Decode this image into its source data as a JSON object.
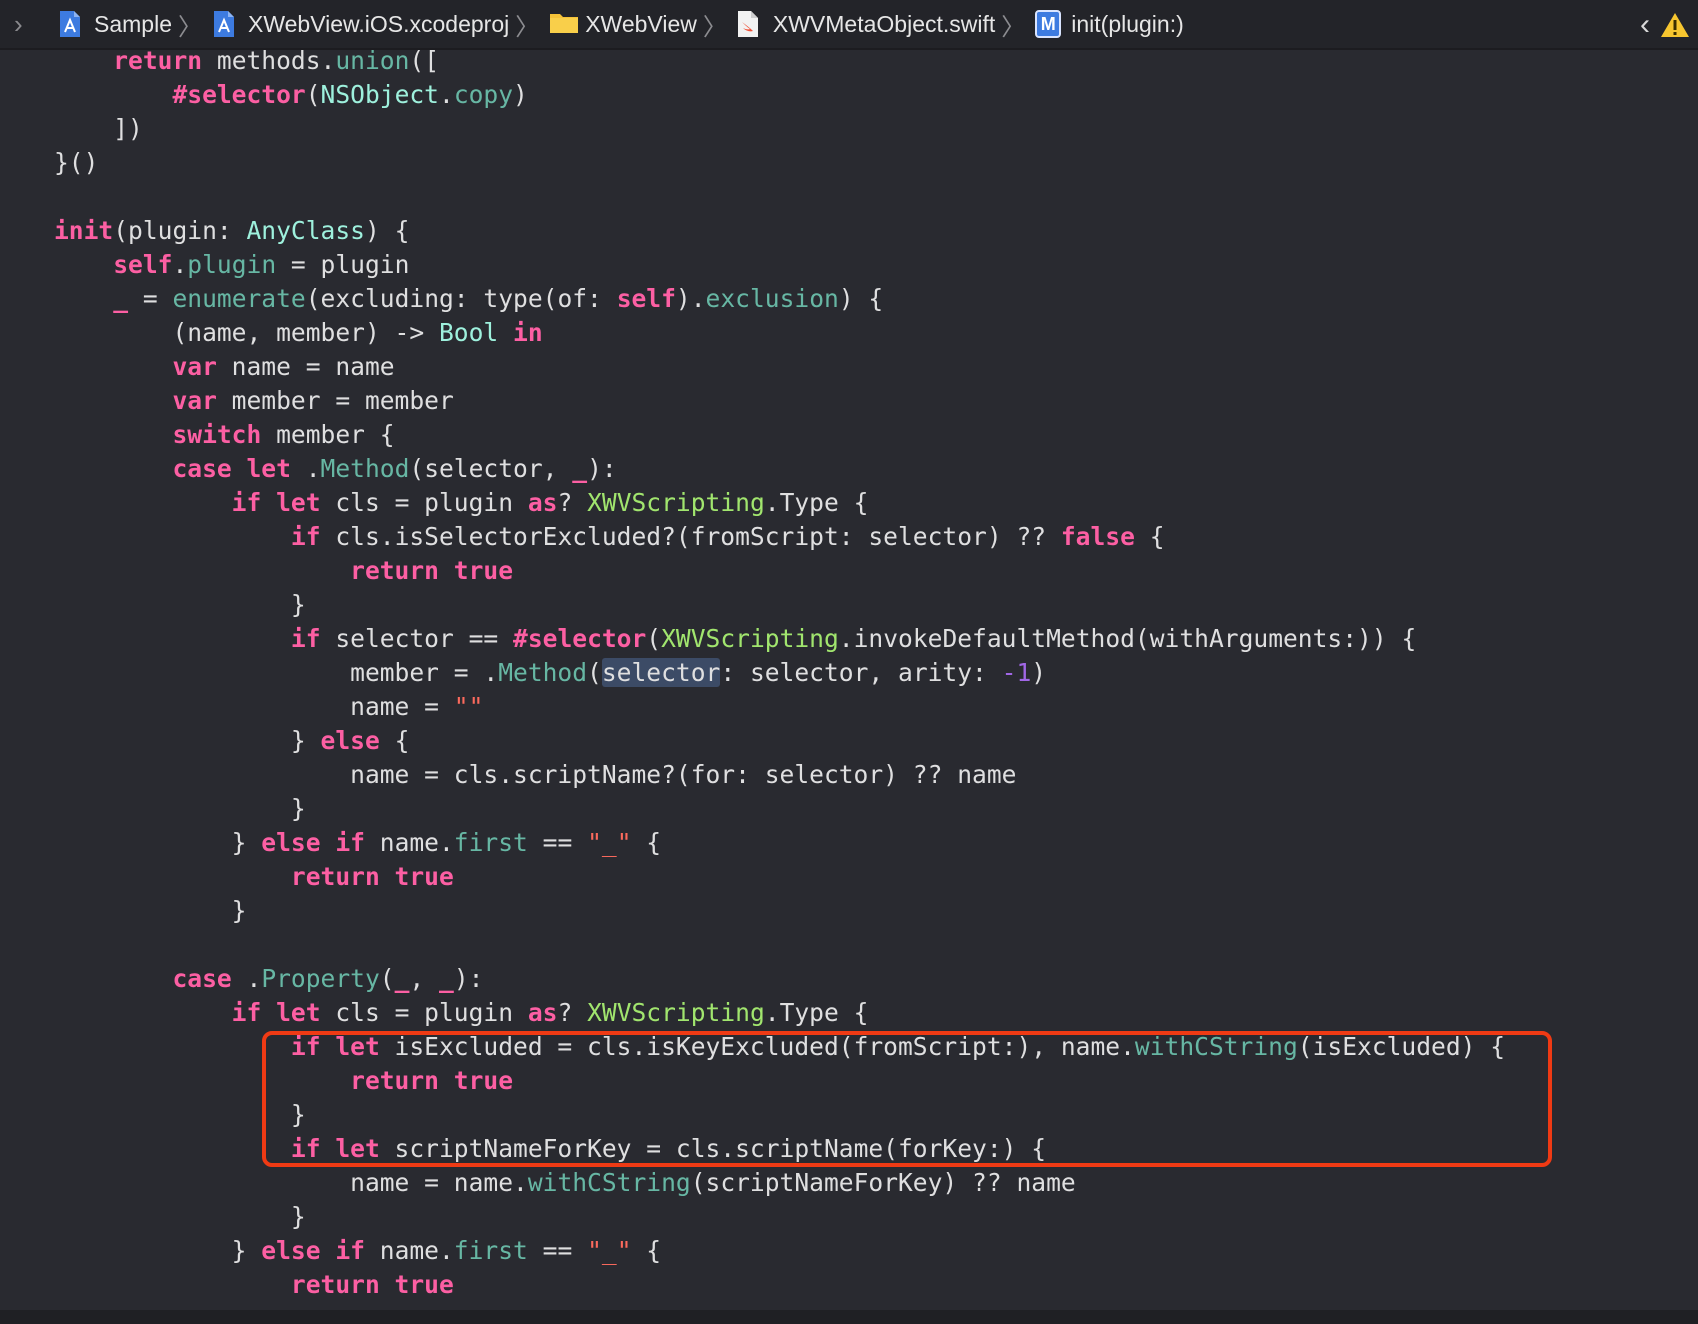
{
  "breadcrumb": [
    {
      "label": "Sample",
      "icon": "xcode-project-icon"
    },
    {
      "label": "XWebView.iOS.xcodeproj",
      "icon": "xcode-project-icon"
    },
    {
      "label": "XWebView",
      "icon": "folder-icon"
    },
    {
      "label": "XWVMetaObject.swift",
      "icon": "swift-file-icon"
    },
    {
      "label": "init(plugin:)",
      "icon": "method-symbol-icon"
    }
  ],
  "method_badge": "M",
  "editor": {
    "lines": [
      [
        [
          "    return",
          "kw"
        ],
        [
          " methods.",
          ""
        ],
        [
          "union",
          "proj"
        ],
        [
          "([",
          ""
        ]
      ],
      [
        [
          "        #selector",
          "kw"
        ],
        [
          "(",
          ""
        ],
        [
          "NSObject",
          "cls"
        ],
        [
          ".",
          ""
        ],
        [
          "copy",
          "proj"
        ],
        [
          ")",
          ""
        ]
      ],
      [
        [
          "    ])",
          ""
        ]
      ],
      [
        [
          "}()",
          ""
        ]
      ],
      [
        [
          "",
          ""
        ]
      ],
      [
        [
          "init",
          "kw"
        ],
        [
          "(plugin: ",
          ""
        ],
        [
          "AnyClass",
          "cls"
        ],
        [
          ") {",
          ""
        ]
      ],
      [
        [
          "    self",
          "kw"
        ],
        [
          ".",
          ""
        ],
        [
          "plugin",
          "proj"
        ],
        [
          " = plugin",
          ""
        ]
      ],
      [
        [
          "    _",
          "kw"
        ],
        [
          " = ",
          ""
        ],
        [
          "enumerate",
          "proj"
        ],
        [
          "(excluding: type(of: ",
          ""
        ],
        [
          "self",
          "kw"
        ],
        [
          ").",
          ""
        ],
        [
          "exclusion",
          "proj"
        ],
        [
          ") {",
          ""
        ]
      ],
      [
        [
          "        (name, member) -> ",
          ""
        ],
        [
          "Bool",
          "cls"
        ],
        [
          " ",
          ""
        ],
        [
          "in",
          "kw"
        ]
      ],
      [
        [
          "        var",
          "kw"
        ],
        [
          " name = name",
          ""
        ]
      ],
      [
        [
          "        var",
          "kw"
        ],
        [
          " member = member",
          ""
        ]
      ],
      [
        [
          "        switch",
          "kw"
        ],
        [
          " member {",
          ""
        ]
      ],
      [
        [
          "        case let",
          "kw"
        ],
        [
          " .",
          ""
        ],
        [
          "Method",
          "proj"
        ],
        [
          "(selector, ",
          ""
        ],
        [
          "_",
          "kw"
        ],
        [
          "):",
          ""
        ]
      ],
      [
        [
          "            if let",
          "kw"
        ],
        [
          " cls = plugin ",
          ""
        ],
        [
          "as",
          "kw"
        ],
        [
          "? ",
          ""
        ],
        [
          "XWVScripting",
          "pf"
        ],
        [
          ".Type {",
          ""
        ]
      ],
      [
        [
          "                if",
          "kw"
        ],
        [
          " cls.isSelectorExcluded?(fromScript: selector) ?? ",
          ""
        ],
        [
          "false",
          "kw"
        ],
        [
          " {",
          ""
        ]
      ],
      [
        [
          "                    return true",
          "kw"
        ]
      ],
      [
        [
          "                }",
          ""
        ]
      ],
      [
        [
          "                if",
          "kw"
        ],
        [
          " selector == ",
          ""
        ],
        [
          "#selector",
          "kw"
        ],
        [
          "(",
          ""
        ],
        [
          "XWVScripting",
          "pf"
        ],
        [
          ".invokeDefaultMethod(withArguments:)) {",
          ""
        ]
      ],
      [
        [
          "                    member = .",
          ""
        ],
        [
          "Method",
          "proj"
        ],
        [
          "(",
          ""
        ],
        [
          "selector",
          "hl"
        ],
        [
          ": selector, arity: ",
          ""
        ],
        [
          "-1",
          "sym"
        ],
        [
          ")",
          ""
        ]
      ],
      [
        [
          "                    name = ",
          ""
        ],
        [
          "\"\"",
          "str"
        ]
      ],
      [
        [
          "                } ",
          ""
        ],
        [
          "else",
          "kw"
        ],
        [
          " {",
          ""
        ]
      ],
      [
        [
          "                    name = cls.scriptName?(for: selector) ?? name",
          ""
        ]
      ],
      [
        [
          "                }",
          ""
        ]
      ],
      [
        [
          "            } ",
          ""
        ],
        [
          "else if",
          "kw"
        ],
        [
          " name.",
          ""
        ],
        [
          "first",
          "proj"
        ],
        [
          " == ",
          ""
        ],
        [
          "\"_\"",
          "str"
        ],
        [
          " {",
          ""
        ]
      ],
      [
        [
          "                return true",
          "kw"
        ]
      ],
      [
        [
          "            }",
          ""
        ]
      ],
      [
        [
          "",
          ""
        ]
      ],
      [
        [
          "        case",
          "kw"
        ],
        [
          " .",
          ""
        ],
        [
          "Property",
          "proj"
        ],
        [
          "(",
          ""
        ],
        [
          "_",
          "kw"
        ],
        [
          ", ",
          ""
        ],
        [
          "_",
          "kw"
        ],
        [
          "):",
          ""
        ]
      ],
      [
        [
          "            if let",
          "kw"
        ],
        [
          " cls = plugin ",
          ""
        ],
        [
          "as",
          "kw"
        ],
        [
          "? ",
          ""
        ],
        [
          "XWVScripting",
          "pf"
        ],
        [
          ".Type {",
          ""
        ]
      ],
      [
        [
          "                if let",
          "kw"
        ],
        [
          " isExcluded = cls.isKeyExcluded(fromScript:), name.",
          ""
        ],
        [
          "withCString",
          "proj"
        ],
        [
          "(isExcluded) {",
          ""
        ]
      ],
      [
        [
          "                    return true",
          "kw"
        ]
      ],
      [
        [
          "                }",
          ""
        ]
      ],
      [
        [
          "                if let",
          "kw"
        ],
        [
          " scriptNameForKey = cls.scriptName(forKey:) {",
          ""
        ]
      ],
      [
        [
          "                    name = name.",
          ""
        ],
        [
          "withCString",
          "proj"
        ],
        [
          "(scriptNameForKey) ?? name",
          ""
        ]
      ],
      [
        [
          "                }",
          ""
        ]
      ],
      [
        [
          "            } ",
          ""
        ],
        [
          "else if",
          "kw"
        ],
        [
          " name.",
          ""
        ],
        [
          "first",
          "proj"
        ],
        [
          " == ",
          ""
        ],
        [
          "\"_\"",
          "str"
        ],
        [
          " {",
          ""
        ]
      ],
      [
        [
          "                return true",
          "kw"
        ]
      ]
    ]
  }
}
